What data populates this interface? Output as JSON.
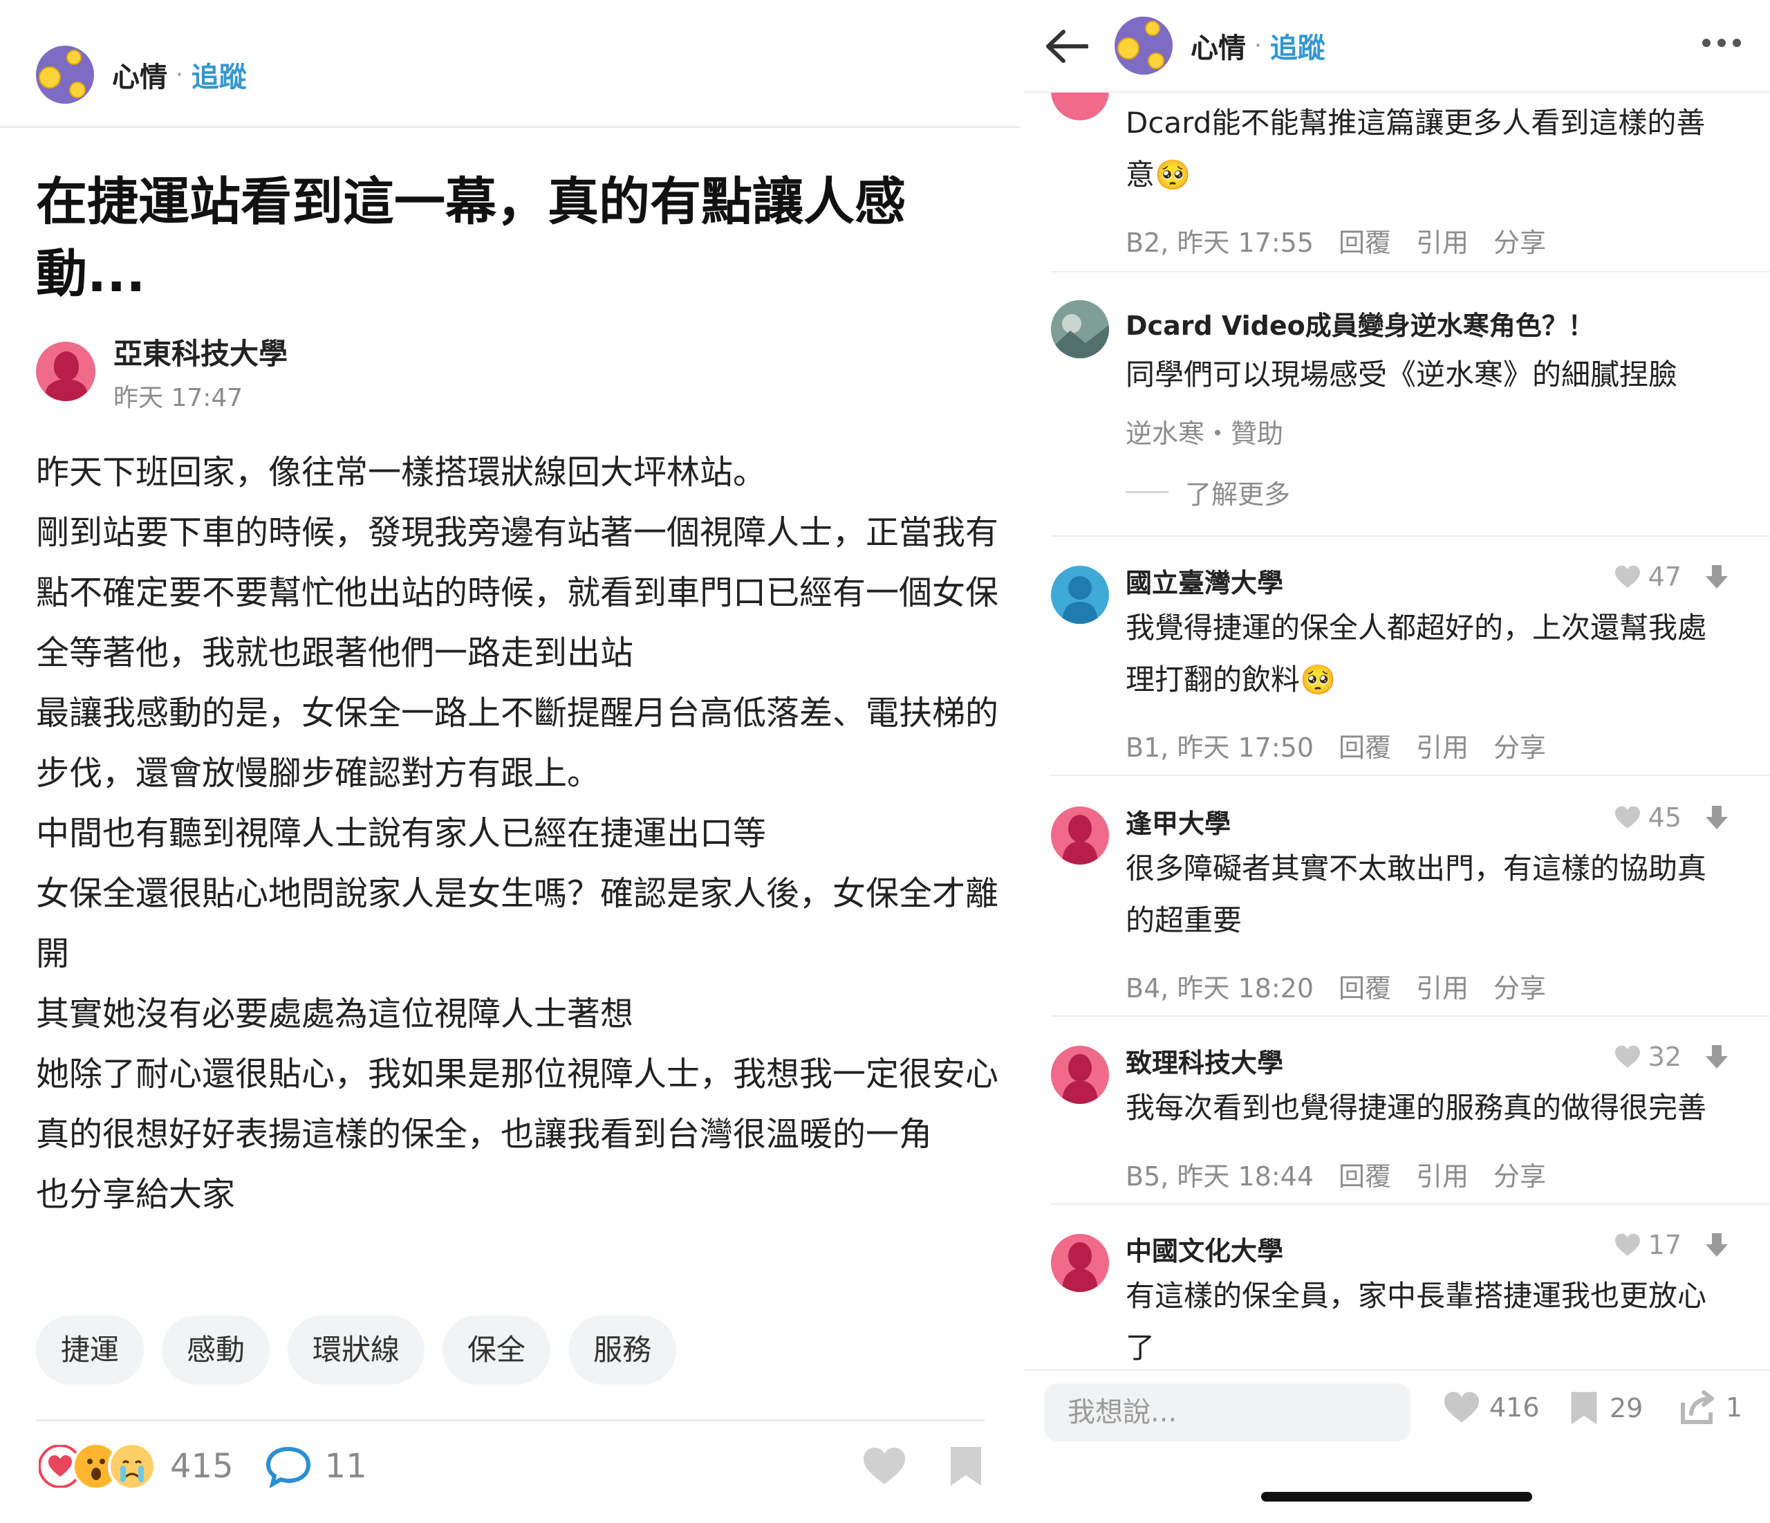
{
  "left_post": {
    "header": {
      "board_name": "心情",
      "separator": "·",
      "follow_label": "追蹤"
    },
    "title": "在捷運站看到這一幕，真的有點讓人感動...",
    "author": {
      "school": "亞東科技大學",
      "time": "昨天 17:47"
    },
    "body_lines": [
      "昨天下班回家，像往常一樣搭環狀線回大坪林站。",
      "剛到站要下車的時候，發現我旁邊有站著一個視障人士，正當我有點不確定要不要幫忙他出站的時候，就看到車門口已經有一個女保全等著他，我就也跟著他們一路走到出站",
      "最讓我感動的是，女保全一路上不斷提醒月台高低落差、電扶梯的步伐，還會放慢腳步確認對方有跟上。",
      "中間也有聽到視障人士說有家人已經在捷運出口等",
      "女保全還很貼心地問說家人是女生嗎？確認是家人後，女保全才離開",
      "其實她沒有必要處處為這位視障人士著想",
      "她除了耐心還很貼心，我如果是那位視障人士，我想我一定很安心",
      "真的很想好好表揚這樣的保全，也讓我看到台灣很溫暖的一角",
      "也分享給大家"
    ],
    "tags": [
      "捷運",
      "感動",
      "環狀線",
      "保全",
      "服務"
    ],
    "reactions": {
      "count": "415",
      "comments": "11"
    }
  },
  "right_panel": {
    "header": {
      "board_name": "心情",
      "separator": "·",
      "follow_label": "追蹤",
      "back_icon": "arrow-left-icon",
      "more_icon": "more-icon"
    },
    "comment_top": {
      "text": "Dcard能不能幫推這篇讓更多人看到這樣的善意🥺",
      "meta": {
        "floor_time": "B2, 昨天 17:55",
        "reply": "回覆",
        "quote": "引用",
        "share": "分享"
      }
    },
    "ad": {
      "title": "Dcard Video成員變身逆水寒角色？！",
      "text": "同學們可以現場感受《逆水寒》的細膩捏臉",
      "sponsor": "逆水寒・贊助",
      "learn_more": "了解更多"
    },
    "comments": [
      {
        "school": "國立臺灣大學",
        "likes": "47",
        "text": "我覺得捷運的保全人都超好的，上次還幫我處理打翻的飲料🥺",
        "floor_time": "B1, 昨天 17:50",
        "reply": "回覆",
        "quote": "引用",
        "share": "分享",
        "avatar_color": "#3fa9d8"
      },
      {
        "school": "逢甲大學",
        "likes": "45",
        "text": "很多障礙者其實不太敢出門，有這樣的協助真的超重要",
        "floor_time": "B4, 昨天 18:20",
        "reply": "回覆",
        "quote": "引用",
        "share": "分享",
        "avatar_color": "#f06a8a"
      },
      {
        "school": "致理科技大學",
        "likes": "32",
        "text": "我每次看到也覺得捷運的服務真的做得很完善",
        "floor_time": "B5, 昨天 18:44",
        "reply": "回覆",
        "quote": "引用",
        "share": "分享",
        "avatar_color": "#f06a8a"
      },
      {
        "school": "中國文化大學",
        "likes": "17",
        "text": "有這樣的保全員，家中長輩搭捷運我也更放心了",
        "avatar_color": "#f06a8a"
      }
    ],
    "bottom_bar": {
      "input_placeholder": "我想說...",
      "likes": "416",
      "bookmarks": "29",
      "shares": "1"
    }
  },
  "colors": {
    "accent": "#3397cf",
    "like": "#e8465a",
    "text_muted": "#8c8c8c",
    "female_avatar": "#f06a8a",
    "male_avatar": "#3fa9d8"
  }
}
